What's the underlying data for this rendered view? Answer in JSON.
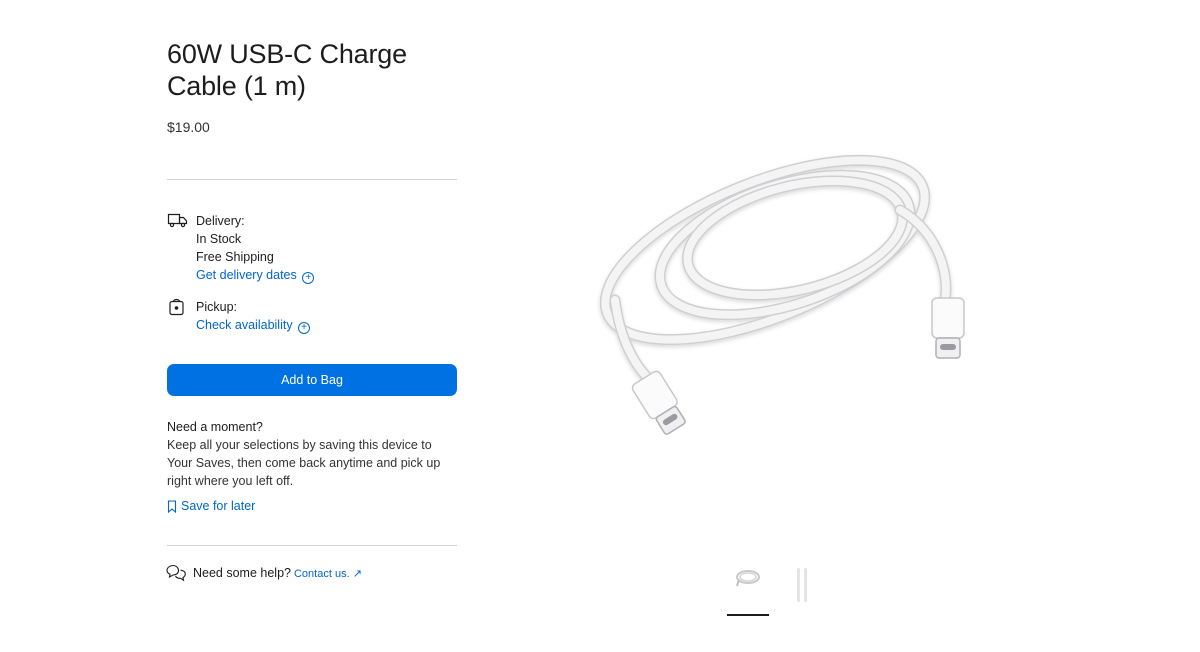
{
  "product": {
    "title": "60W USB-C Charge Cable (1 m)",
    "price": "$19.00"
  },
  "delivery": {
    "label": "Delivery:",
    "stock": "In Stock",
    "shipping": "Free Shipping",
    "link": "Get delivery dates"
  },
  "pickup": {
    "label": "Pickup:",
    "link": "Check availability"
  },
  "actions": {
    "add_to_bag": "Add to Bag"
  },
  "moment": {
    "title": "Need a moment?",
    "body": "Keep all your selections by saving this device to Your Saves, then come back anytime and pick up right where you left off.",
    "save_link": "Save for later"
  },
  "help": {
    "text": "Need some help?",
    "contact": "Contact us."
  },
  "gallery": {
    "selected_index": 0,
    "thumbnail_count": 2
  },
  "colors": {
    "accent": "#0071e3",
    "link": "#0066cc",
    "text": "#1d1d1f"
  },
  "icons": [
    "truck-icon",
    "shopping-bag-icon",
    "plus-circle-icon",
    "bookmark-icon",
    "chat-bubbles-icon",
    "external-arrow-icon"
  ]
}
